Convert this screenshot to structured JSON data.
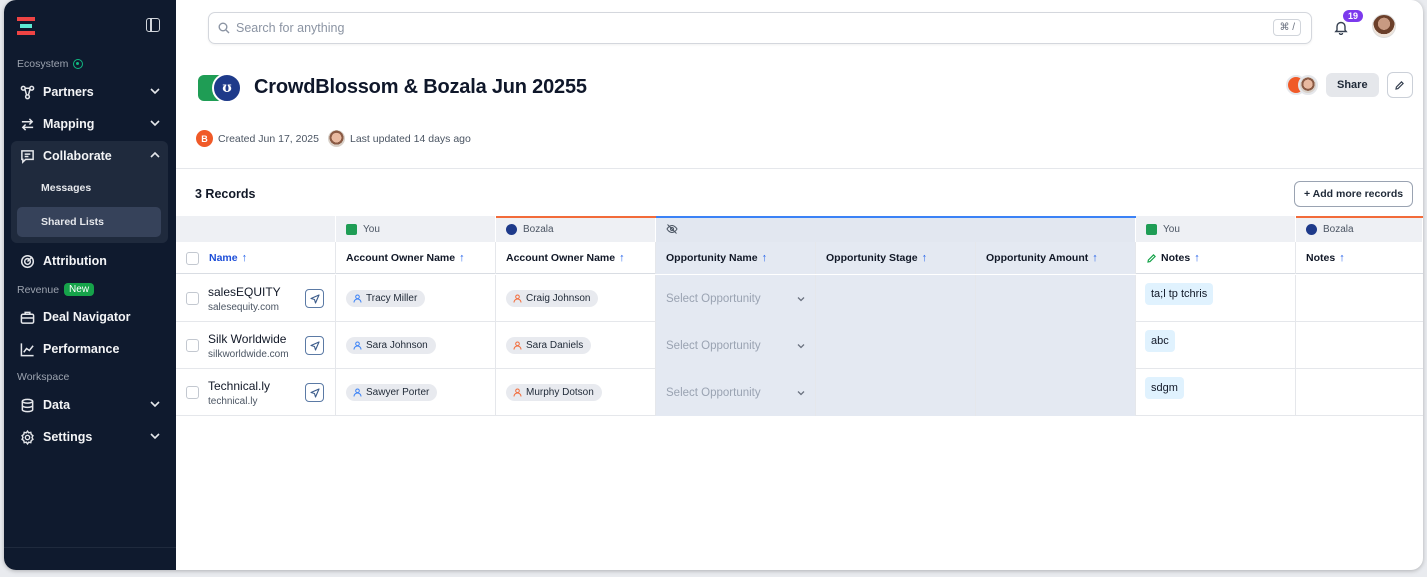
{
  "sidebar": {
    "section_ecosystem": "Ecosystem",
    "section_revenue": "Revenue",
    "new_badge": "New",
    "section_workspace": "Workspace",
    "items": {
      "partners": "Partners",
      "mapping": "Mapping",
      "collaborate": "Collaborate",
      "messages": "Messages",
      "shared_lists": "Shared Lists",
      "attribution": "Attribution",
      "deal_navigator": "Deal Navigator",
      "performance": "Performance",
      "data": "Data",
      "settings": "Settings"
    },
    "active_item": "Shared Lists"
  },
  "header": {
    "search_placeholder": "Search for anything",
    "search_shortcut": "⌘ /",
    "notification_count": "19"
  },
  "page": {
    "title": "CrowdBlossom & Bozala Jun 20255",
    "created_avatar_letter": "B",
    "created": "Created Jun 17, 2025",
    "updated": "Last updated 14 days ago",
    "share_label": "Share",
    "records_count": "3 Records",
    "add_records_label": "+ Add more records"
  },
  "table": {
    "groups": {
      "you_1": "You",
      "bozala_1": "Bozala",
      "you_2": "You",
      "bozala_2": "Bozala"
    },
    "columns": {
      "name": "Name",
      "account_owner_you": "Account Owner Name",
      "account_owner_bozala": "Account Owner Name",
      "opportunity_name": "Opportunity Name",
      "opportunity_stage": "Opportunity Stage",
      "opportunity_amount": "Opportunity Amount",
      "notes_you": "Notes",
      "notes_bozala": "Notes"
    },
    "select_placeholder": "Select Opportunity",
    "rows": [
      {
        "name": "salesEQUITY",
        "domain": "salesequity.com",
        "owner_you": "Tracy Miller",
        "owner_bozala": "Craig Johnson",
        "notes_you": "ta;l tp tchris",
        "notes_bozala": ""
      },
      {
        "name": "Silk Worldwide",
        "domain": "silkworldwide.com",
        "owner_you": "Sara Johnson",
        "owner_bozala": "Sara Daniels",
        "notes_you": "abc",
        "notes_bozala": ""
      },
      {
        "name": "Technical.ly",
        "domain": "technical.ly",
        "owner_you": "Sawyer Porter",
        "owner_bozala": "Murphy Dotson",
        "notes_you": "sdgm",
        "notes_bozala": ""
      }
    ]
  },
  "colors": {
    "sidebar_bg": "#0f1a2e",
    "accent_blue": "#2563eb",
    "orange": "#f26b3a",
    "shared_cell_bg": "#e4e9f2",
    "note_bg": "#e0f2fe",
    "new_badge": "#16a34a",
    "notif_badge": "#7c3aed"
  },
  "icons": [
    "logo-icon",
    "sidebar-toggle-icon",
    "partners-icon",
    "mapping-icon",
    "collaborate-icon",
    "attribution-icon",
    "deal-navigator-icon",
    "performance-icon",
    "data-icon",
    "settings-icon",
    "chevron-down-icon",
    "chevron-up-icon",
    "search-icon",
    "bell-icon",
    "edit-icon",
    "send-icon",
    "person-icon",
    "eye-off-icon",
    "pencil-icon"
  ]
}
